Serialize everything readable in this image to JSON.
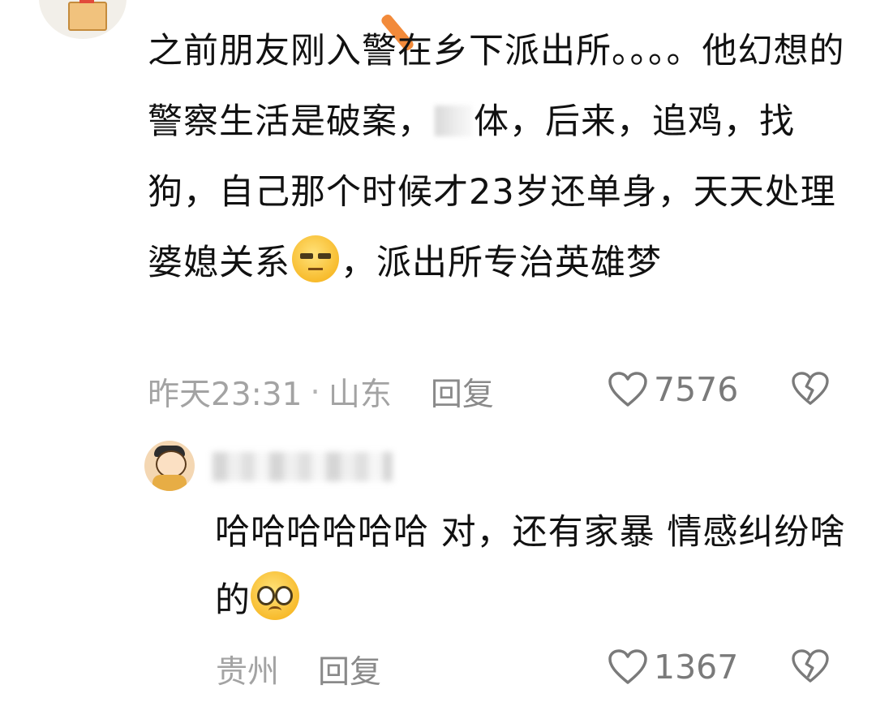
{
  "main_comment": {
    "text_part1": "之前朋友刚入警在乡下派出所。。。。他幻想的警察生活是破案，",
    "text_part2": "体，后来，追鸡，找狗，自己那个时候才23岁还单身，天天处理婆媳关系",
    "text_part3": "，派出所专治英雄梦",
    "emoji_name": "unamused-face-icon",
    "timestamp": "昨天23:31",
    "separator": "·",
    "location": "山东",
    "reply_label": "回复",
    "like_count": "7576"
  },
  "reply_comment": {
    "text": "哈哈哈哈哈哈 对，还有家暴 情感纠纷啥的",
    "emoji_name": "pleading-face-icon",
    "location": "贵州",
    "reply_label": "回复",
    "like_count": "1367"
  },
  "colors": {
    "meta_gray": "#a3a3a3",
    "icon_gray": "#7a7a7a",
    "emoji_yellow": "#f7b928",
    "mark_orange": "#f28a3a"
  }
}
